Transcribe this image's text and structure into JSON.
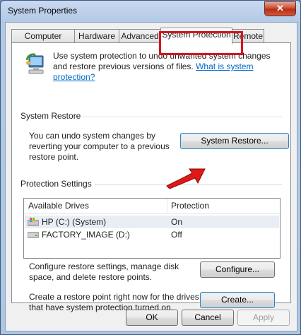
{
  "window": {
    "title": "System Properties",
    "close_glyph": "✕"
  },
  "tabs": [
    {
      "label": "Computer Name"
    },
    {
      "label": "Hardware"
    },
    {
      "label": "Advanced"
    },
    {
      "label": "System Protection"
    },
    {
      "label": "Remote"
    }
  ],
  "intro": {
    "text": "Use system protection to undo unwanted system changes and restore previous versions of files.",
    "link": "What is system protection?"
  },
  "system_restore": {
    "group_label": "System Restore",
    "description": "You can undo system changes by reverting your computer to a previous restore point.",
    "button": "System Restore..."
  },
  "protection_settings": {
    "group_label": "Protection Settings",
    "columns": [
      "Available Drives",
      "Protection"
    ],
    "drives": [
      {
        "name": "HP (C:) (System)",
        "protection": "On",
        "icon": "system-drive-icon"
      },
      {
        "name": "FACTORY_IMAGE (D:)",
        "protection": "Off",
        "icon": "disk-drive-icon"
      }
    ],
    "configure_text": "Configure restore settings, manage disk space, and delete restore points.",
    "configure_button": "Configure...",
    "create_text": "Create a restore point right now for the drives that have system protection turned on.",
    "create_button": "Create..."
  },
  "footer": {
    "ok": "OK",
    "cancel": "Cancel",
    "apply": "Apply"
  },
  "colors": {
    "highlight": "#d8141c",
    "link": "#0066cc"
  }
}
